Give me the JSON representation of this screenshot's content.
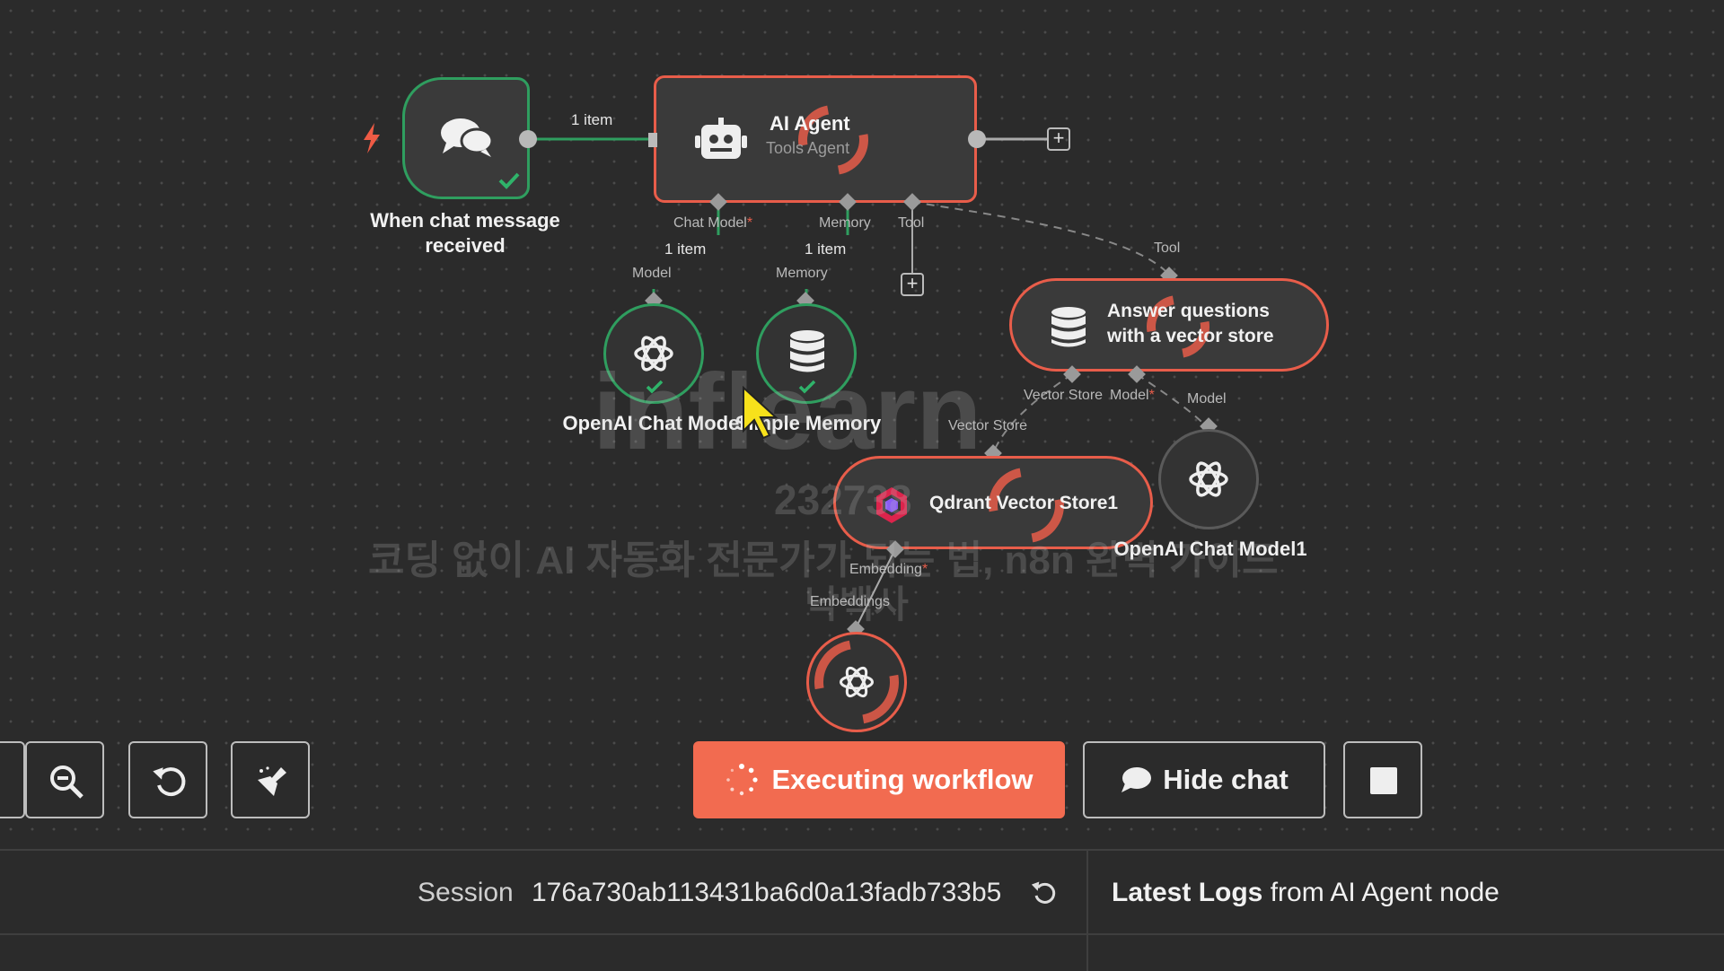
{
  "nodes": {
    "trigger": {
      "label": "When chat message received"
    },
    "agent": {
      "title": "AI Agent",
      "subtitle": "Tools Agent"
    },
    "openai_chat_model": {
      "label": "OpenAI Chat Model"
    },
    "simple_memory": {
      "label": "Simple Memory"
    },
    "vector_tool": {
      "label_line1": "Answer questions",
      "label_line2": "with a vector store"
    },
    "qdrant": {
      "label": "Qdrant Vector Store1"
    },
    "openai_chat_model1": {
      "label": "OpenAI Chat Model1"
    },
    "embeddings": {
      "label": ""
    }
  },
  "ports": {
    "chat_model": "Chat Model",
    "memory": "Memory",
    "tool": "Tool",
    "model": "Model",
    "memory_in": "Memory",
    "tool_in": "Tool",
    "vector_store_out": "Vector Store",
    "model_out": "Model",
    "model_in": "Model",
    "vector_store_in": "Vector Store",
    "embedding_out": "Embedding",
    "embeddings_in": "Embeddings",
    "required_mark": "*"
  },
  "edge_counts": {
    "trigger_agent": "1 item",
    "chat_model": "1 item",
    "memory": "1 item"
  },
  "toolbar": {
    "execute_label": "Executing workflow",
    "hide_chat_label": "Hide chat"
  },
  "bottom": {
    "session_label": "Session",
    "session_id": "176a730ab113431ba6d0a13fadb733b5",
    "logs_bold": "Latest Logs",
    "logs_rest": " from AI Agent node"
  },
  "watermark": {
    "brand": "inflearn",
    "number": "232738",
    "line": "코딩 없이 AI 자동화 전문가가 되는 법, n8n 완벽 가이드",
    "author": "낙백사"
  },
  "colors": {
    "accent": "#f26b50",
    "running": "#e85d4a",
    "success": "#2f9e5f",
    "background": "#2b2b2b"
  }
}
